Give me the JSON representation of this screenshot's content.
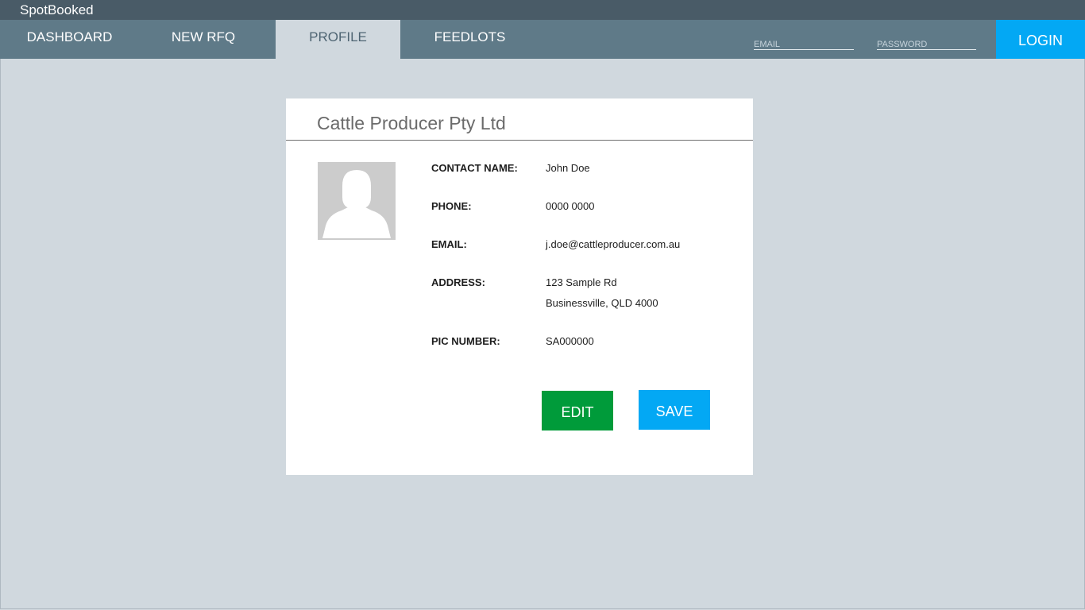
{
  "app": {
    "title": "SpotBooked"
  },
  "nav": {
    "tabs": [
      {
        "label": "DASHBOARD",
        "active": false
      },
      {
        "label": "NEW RFQ",
        "active": false
      },
      {
        "label": "PROFILE",
        "active": true
      },
      {
        "label": "FEEDLOTS",
        "active": false
      }
    ]
  },
  "login": {
    "email_placeholder": "EMAIL",
    "email_value": "",
    "password_placeholder": "PASSWORD",
    "password_value": "",
    "button_label": "LOGIN"
  },
  "profile": {
    "company_name": "Cattle Producer Pty Ltd",
    "avatar_icon": "user-silhouette-icon",
    "fields": {
      "contact_name": {
        "label": "CONTACT NAME:",
        "value": "John Doe"
      },
      "phone": {
        "label": "PHONE:",
        "value": "0000 0000"
      },
      "email": {
        "label": "EMAIL:",
        "value": "j.doe@cattleproducer.com.au"
      },
      "address": {
        "label": "ADDRESS:",
        "line1": "123 Sample Rd",
        "line2": "Businessville, QLD 4000"
      },
      "pic_number": {
        "label": "PIC NUMBER:",
        "value": "SA000000"
      }
    },
    "edit_label": "EDIT",
    "save_label": "SAVE"
  },
  "colors": {
    "title_bar": "#495b67",
    "nav_bar": "#5f7a88",
    "background": "#d0d8de",
    "login_button": "#03a8f4",
    "edit_button": "#009b3a",
    "save_button": "#03a8f4"
  }
}
